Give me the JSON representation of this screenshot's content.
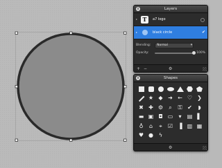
{
  "colors": {
    "canvas_bg": "#b9b9b9",
    "shape_fill": "#8b8b8b",
    "shape_stroke": "#2a2a2a",
    "selection_blue": "#2f7ee0",
    "panel_bg": "#2c2c2c"
  },
  "layers_panel": {
    "title": "Layers",
    "close_glyph": "x",
    "layers": [
      {
        "thumb": "T",
        "name": "a7 logo",
        "selected": false
      },
      {
        "thumb": "",
        "name": "black circle",
        "selected": true,
        "check": "✔"
      }
    ],
    "blending_label": "Blending:",
    "blending_value": "Normal",
    "opacity_label": "Opacity:",
    "opacity_value": "100%",
    "opacity_fraction": 1.0,
    "footer": {
      "add": "+",
      "remove": "−",
      "gear": "⚙"
    }
  },
  "shapes_panel": {
    "title": "Shapes",
    "close_glyph": "x",
    "rows": [
      [
        "square",
        "rounded-square",
        "circle",
        "ellipse",
        "triangle",
        "hexagon",
        "pentagon"
      ],
      [
        "line",
        "star",
        "diamond",
        "arrow-right",
        "arrow-left",
        "heart-outline",
        "chevron"
      ],
      [
        "x-mark",
        "plus",
        "gear",
        "magnifier",
        "lock",
        "check",
        "speech-bubble"
      ],
      [
        "folder",
        "picture",
        "camera",
        "monitor",
        "bookmark",
        "book",
        "signal"
      ],
      [
        "person",
        "house",
        "pin",
        "checkmark-box",
        "bar-chart",
        "document",
        "calendar"
      ],
      [
        "heart",
        "drop",
        "lightning",
        "",
        "",
        "",
        ""
      ]
    ],
    "glyphs": {
      "star": "★",
      "diamond": "◆",
      "arrow-right": "➜",
      "arrow-left": "←",
      "heart-outline": "♡",
      "chevron": "❯",
      "x-mark": "✖",
      "plus": "✚",
      "gear": "⚙",
      "magnifier": "⌕",
      "lock": "⚿",
      "check": "✔",
      "speech-bubble": "◗",
      "folder": "▬",
      "picture": "▣",
      "camera": "◘",
      "monitor": "▭",
      "bookmark": "▾",
      "book": "▤",
      "signal": "▌",
      "person": "♁",
      "house": "⌂",
      "pin": "⌖",
      "checkmark-box": "☑",
      "bar-chart": "▐",
      "document": "▥",
      "calendar": "▦",
      "heart": "♥",
      "drop": "●",
      "lightning": "ϟ"
    },
    "footer": {
      "gear": "⚙"
    }
  }
}
